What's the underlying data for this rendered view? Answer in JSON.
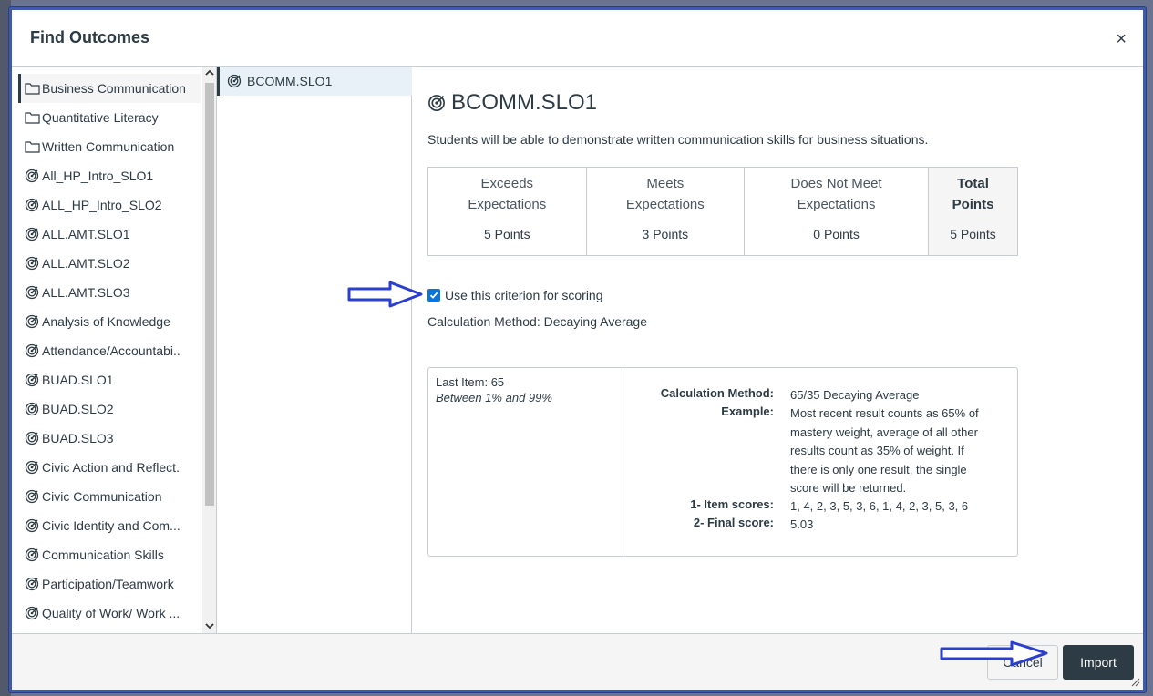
{
  "dialog": {
    "title": "Find Outcomes",
    "close_glyph": "×"
  },
  "left_list": {
    "items": [
      {
        "label": "Business Communication",
        "icon": "folder-icon",
        "selected": true
      },
      {
        "label": "Quantitative Literacy",
        "icon": "folder-icon"
      },
      {
        "label": "Written Communication",
        "icon": "folder-icon"
      },
      {
        "label": "All_HP_Intro_SLO1",
        "icon": "outcome-icon"
      },
      {
        "label": "ALL_HP_Intro_SLO2",
        "icon": "outcome-icon"
      },
      {
        "label": "ALL.AMT.SLO1",
        "icon": "outcome-icon"
      },
      {
        "label": "ALL.AMT.SLO2",
        "icon": "outcome-icon"
      },
      {
        "label": "ALL.AMT.SLO3",
        "icon": "outcome-icon"
      },
      {
        "label": "Analysis of Knowledge",
        "icon": "outcome-icon"
      },
      {
        "label": "Attendance/Accountabi..",
        "icon": "outcome-icon"
      },
      {
        "label": "BUAD.SLO1",
        "icon": "outcome-icon"
      },
      {
        "label": "BUAD.SLO2",
        "icon": "outcome-icon"
      },
      {
        "label": "BUAD.SLO3",
        "icon": "outcome-icon"
      },
      {
        "label": "Civic Action and Reflect.",
        "icon": "outcome-icon"
      },
      {
        "label": "Civic Communication",
        "icon": "outcome-icon"
      },
      {
        "label": "Civic Identity and Com...",
        "icon": "outcome-icon"
      },
      {
        "label": "Communication Skills",
        "icon": "outcome-icon"
      },
      {
        "label": "Participation/Teamwork",
        "icon": "outcome-icon"
      },
      {
        "label": "Quality of Work/ Work ...",
        "icon": "outcome-icon"
      }
    ]
  },
  "middle_list": {
    "items": [
      {
        "label": "BCOMM.SLO1",
        "icon": "outcome-icon",
        "selected": true
      }
    ]
  },
  "detail": {
    "title": "BCOMM.SLO1",
    "description": "Students will be able to demonstrate written communication skills for business situations.",
    "rubric": {
      "columns": [
        {
          "line1": "Exceeds",
          "line2": "Expectations",
          "points": "5 Points"
        },
        {
          "line1": "Meets",
          "line2": "Expectations",
          "points": "3 Points"
        },
        {
          "line1": "Does Not Meet",
          "line2": "Expectations",
          "points": "0 Points"
        }
      ],
      "total": {
        "line1": "Total",
        "line2": "Points",
        "points": "5 Points"
      }
    },
    "use_criterion_label": "Use this criterion for scoring",
    "use_criterion_checked": true,
    "calculation_method_line": "Calculation Method: Decaying Average",
    "calc_box": {
      "last_item": "Last Item: 65",
      "range": "Between 1% and 99%",
      "method_key": "Calculation Method:",
      "method_value": "65/35 Decaying Average",
      "example_key": "Example:",
      "example_lines": [
        "Most recent result counts as 65% of",
        "mastery weight, average of all other",
        "results count as 35% of weight. If",
        "there is only one result, the single",
        "score will be returned."
      ],
      "item_scores_key": "1- Item scores:",
      "item_scores_value": "1, 4, 2, 3, 5, 3, 6, 1, 4, 2, 3, 5, 3, 6",
      "final_score_key": "2- Final score:",
      "final_score_value": "5.03"
    }
  },
  "footer": {
    "cancel_label": "Cancel",
    "import_label": "Import"
  },
  "colors": {
    "accent": "#2d3b45",
    "annotation_arrow": "#2b3fcf",
    "checkbox": "#0b74d9"
  }
}
